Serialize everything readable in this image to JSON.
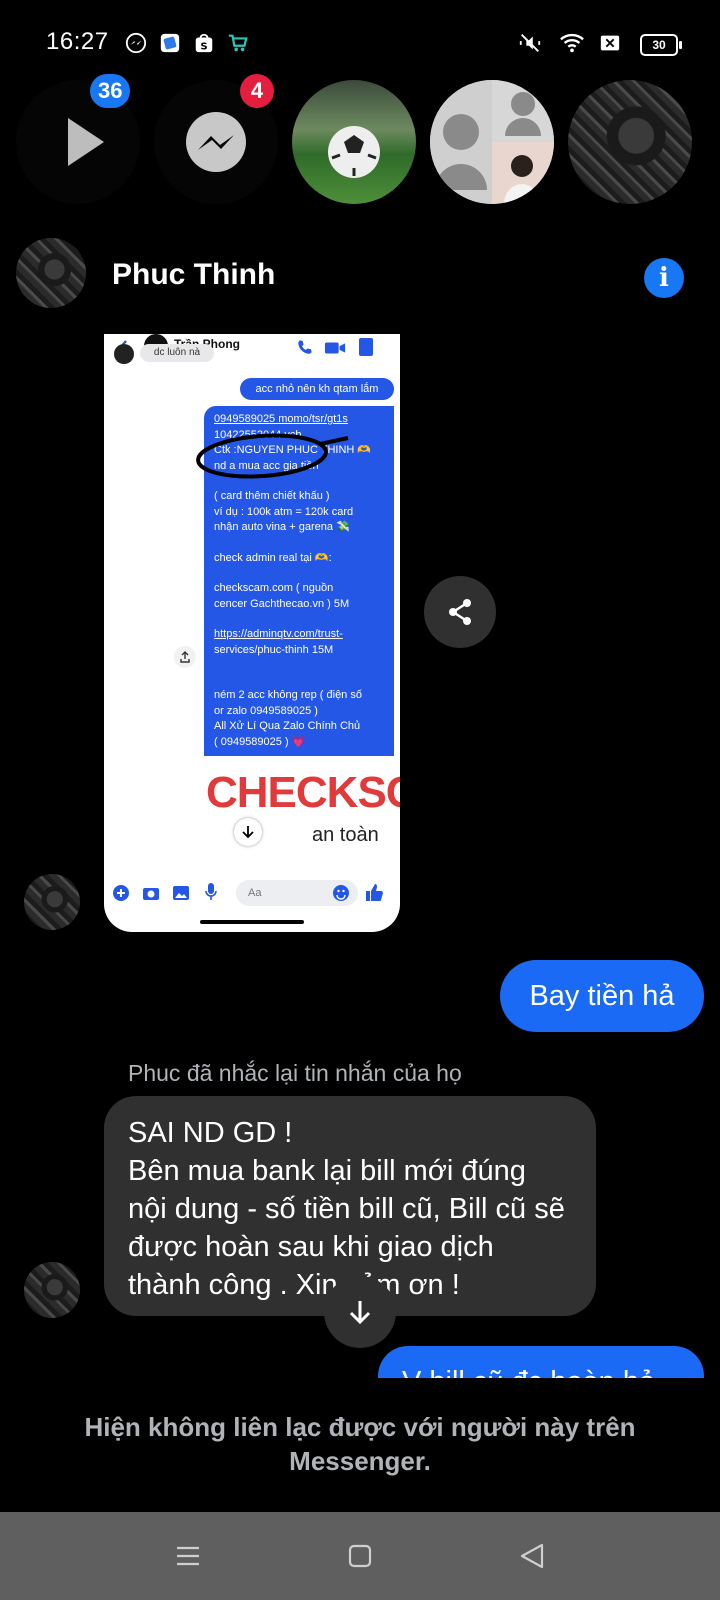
{
  "status_bar": {
    "time": "16:27",
    "battery": "30"
  },
  "bubbles": {
    "video_badge": "36",
    "messenger_badge": "4"
  },
  "header": {
    "name": "Phuc Thinh"
  },
  "shared_screenshot": {
    "contact_name": "Trần Phong",
    "prev_text": "dc luôn nà",
    "small_msg": "acc nhỏ nên kh qtam lắm",
    "lines": [
      "0949589025 momo/tsr/gt1s",
      "10422552044 vcb",
      "Ctk :NGUYEN PHUC THINH 🫶",
      "nd a mua acc gia tiền",
      "",
      "( card thêm chiết khấu )",
      "ví dụ : 100k atm = 120k card",
      "nhận auto vina + garena 💸",
      "",
      "check admin real tại 🫶:",
      "",
      "checkscam.com ( nguồn",
      "cencer Gachthecao.vn ) 5M",
      "",
      "https://adminqtv.com/trust-",
      "services/phuc-thinh     15M",
      "",
      "",
      "ném 2 acc không rep ( điện số",
      "or zalo 0949589025 )",
      "All Xử Lí Qua Zalo Chính Chủ",
      "( 0949589025 ) 💗"
    ],
    "banner_word": "CHECKSC",
    "banner_sub": "an toàn",
    "composer_placeholder": "Aa"
  },
  "messages": {
    "outgoing_1": "Bay tiền hả",
    "reply_note": "Phuc đã nhắc lại tin nhắn của họ",
    "incoming": "SAI ND GD !\nBên mua bank lại bill mới đúng nội dung - số tiền bill cũ, Bill cũ sẽ được hoàn sau khi giao dịch thành công . Xin cảm ơn !",
    "outgoing_2_partial": "V bill cũ đc hoàn hả"
  },
  "notice": "Hiện không liên lạc được với người này trên Messenger.",
  "colors": {
    "accent": "#1a6af5",
    "badge_blue": "#1877f2",
    "badge_red": "#e41e3f",
    "incoming_bubble": "#303030",
    "navbar": "#5f5f5f"
  }
}
